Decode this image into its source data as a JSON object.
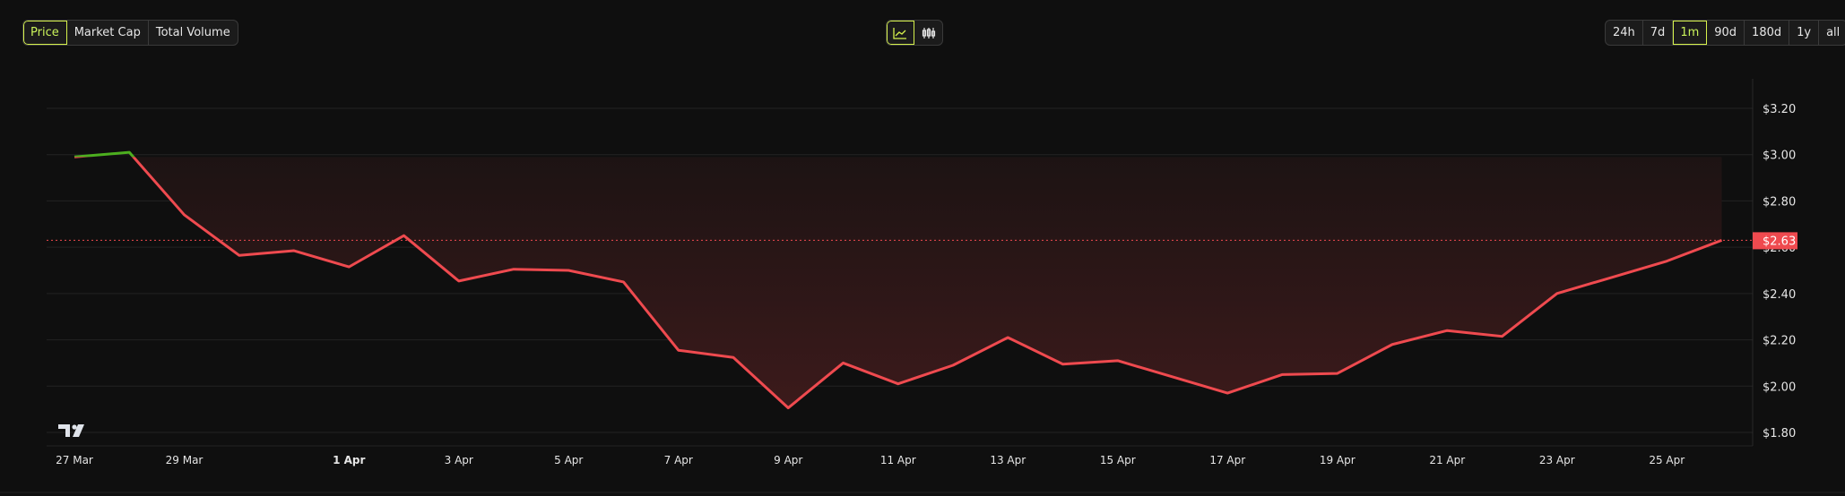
{
  "metric_tabs": [
    {
      "label": "Price",
      "active": true
    },
    {
      "label": "Market Cap",
      "active": false
    },
    {
      "label": "Total Volume",
      "active": false
    }
  ],
  "chart_types": [
    {
      "icon": "line-chart-icon",
      "active": true
    },
    {
      "icon": "candlestick-icon",
      "active": false
    }
  ],
  "ranges": [
    {
      "label": "24h",
      "active": false
    },
    {
      "label": "7d",
      "active": false
    },
    {
      "label": "1m",
      "active": true
    },
    {
      "label": "90d",
      "active": false
    },
    {
      "label": "180d",
      "active": false
    },
    {
      "label": "1y",
      "active": false
    },
    {
      "label": "all",
      "active": false
    }
  ],
  "colors": {
    "accent": "#d6f24c",
    "down": "#ef4a4f",
    "up": "#4caf1f",
    "background": "#0f0f0f"
  },
  "chart_data": {
    "type": "area",
    "baseline": 2.99,
    "current_price_label": "$2.63",
    "current_price": 2.63,
    "ylim": [
      1.8,
      3.2
    ],
    "y_ticks": [
      {
        "value": 3.2,
        "label": "$3.20"
      },
      {
        "value": 3.0,
        "label": "$3.00"
      },
      {
        "value": 2.8,
        "label": "$2.80"
      },
      {
        "value": 2.6,
        "label": "$2.60"
      },
      {
        "value": 2.4,
        "label": "$2.40"
      },
      {
        "value": 2.2,
        "label": "$2.20"
      },
      {
        "value": 2.0,
        "label": "$2.00"
      },
      {
        "value": 1.8,
        "label": "$1.80"
      }
    ],
    "x": [
      "27 Mar",
      "28 Mar",
      "29 Mar",
      "30 Mar",
      "31 Mar",
      "1 Apr",
      "2 Apr",
      "3 Apr",
      "4 Apr",
      "5 Apr",
      "6 Apr",
      "7 Apr",
      "8 Apr",
      "9 Apr",
      "10 Apr",
      "11 Apr",
      "12 Apr",
      "13 Apr",
      "14 Apr",
      "15 Apr",
      "16 Apr",
      "17 Apr",
      "18 Apr",
      "19 Apr",
      "20 Apr",
      "21 Apr",
      "22 Apr",
      "23 Apr",
      "24 Apr",
      "25 Apr",
      "26 Apr"
    ],
    "values": [
      2.99,
      3.01,
      2.74,
      2.565,
      2.585,
      2.515,
      2.65,
      2.454,
      2.505,
      2.5,
      2.45,
      2.155,
      2.124,
      1.906,
      2.1,
      2.01,
      2.09,
      2.21,
      2.095,
      2.11,
      2.04,
      1.97,
      2.05,
      2.055,
      2.18,
      2.24,
      2.215,
      2.4,
      2.47,
      2.54,
      2.63
    ],
    "x_tick_labels": [
      {
        "index": 0,
        "label": "27 Mar",
        "bold": false
      },
      {
        "index": 2,
        "label": "29 Mar",
        "bold": false
      },
      {
        "index": 5,
        "label": "1 Apr",
        "bold": true
      },
      {
        "index": 7,
        "label": "3 Apr",
        "bold": false
      },
      {
        "index": 9,
        "label": "5 Apr",
        "bold": false
      },
      {
        "index": 11,
        "label": "7 Apr",
        "bold": false
      },
      {
        "index": 13,
        "label": "9 Apr",
        "bold": false
      },
      {
        "index": 15,
        "label": "11 Apr",
        "bold": false
      },
      {
        "index": 17,
        "label": "13 Apr",
        "bold": false
      },
      {
        "index": 19,
        "label": "15 Apr",
        "bold": false
      },
      {
        "index": 21,
        "label": "17 Apr",
        "bold": false
      },
      {
        "index": 23,
        "label": "19 Apr",
        "bold": false
      },
      {
        "index": 25,
        "label": "21 Apr",
        "bold": false
      },
      {
        "index": 27,
        "label": "23 Apr",
        "bold": false
      },
      {
        "index": 29,
        "label": "25 Apr",
        "bold": false
      }
    ],
    "grid": true
  }
}
